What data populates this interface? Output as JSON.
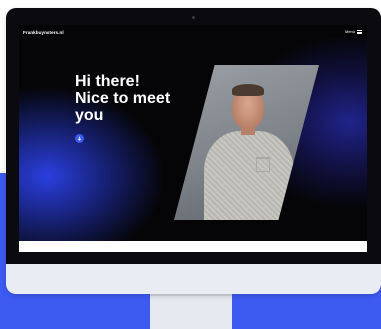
{
  "site": {
    "logo_text": "Frankbuynsters.nl",
    "menu_label": "Menu"
  },
  "hero": {
    "lines": [
      "Hi there!",
      "Nice to meet",
      "you"
    ]
  },
  "colors": {
    "accent": "#3d5af1",
    "screen_background": "#050508",
    "glow": "#2a3fe0"
  },
  "icons": {
    "menu": "hamburger-icon",
    "cta": "arrow-down-icon"
  }
}
